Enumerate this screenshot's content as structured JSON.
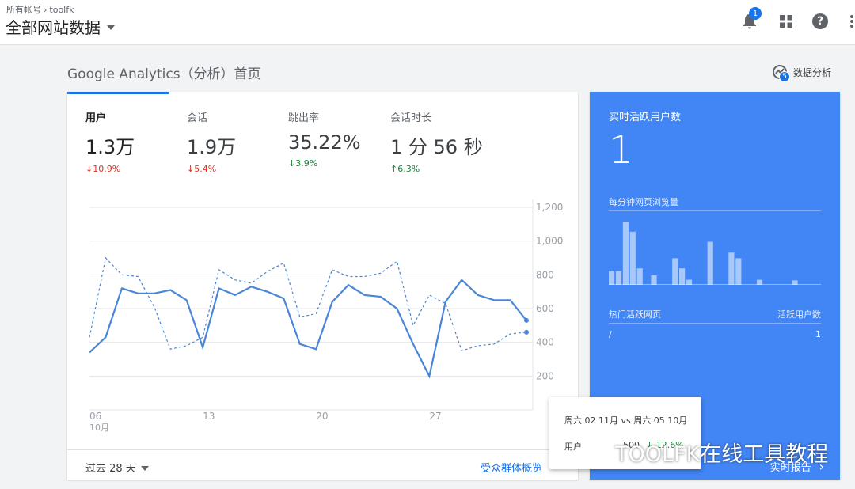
{
  "header": {
    "breadcrumb": [
      "所有帐号",
      "toolfk"
    ],
    "property_title": "全部网站数据",
    "notification_count": "1"
  },
  "page": {
    "title": "Google Analytics（分析）首页",
    "insights_label": "数据分析",
    "insights_count": "5"
  },
  "metrics": [
    {
      "label": "用户",
      "value": "1.3万",
      "change": "↓10.9%",
      "dir": "neg"
    },
    {
      "label": "会话",
      "value": "1.9万",
      "change": "↓5.4%",
      "dir": "neg"
    },
    {
      "label": "跳出率",
      "value": "35.22%",
      "change": "↓3.9%",
      "dir": "pos"
    },
    {
      "label": "会话时长",
      "value": "1 分 56 秒",
      "change": "↑6.3%",
      "dir": "pos"
    }
  ],
  "chart_data": {
    "type": "line",
    "y_tick_labels": [
      "1,200",
      "1,000",
      "800",
      "600",
      "400",
      "200"
    ],
    "ylim": [
      0,
      1200
    ],
    "x_tick_labels": [
      "06",
      "13",
      "20",
      "27"
    ],
    "x_sublabel": "10月",
    "series": [
      {
        "style": "solid",
        "color": "#4a86d8",
        "values": [
          340,
          430,
          720,
          690,
          690,
          710,
          650,
          370,
          720,
          680,
          730,
          700,
          660,
          390,
          360,
          640,
          740,
          680,
          670,
          600,
          390,
          200,
          640,
          770,
          680,
          650,
          650,
          530
        ]
      },
      {
        "style": "dashed",
        "color": "#4a86d8",
        "values": [
          430,
          900,
          800,
          790,
          610,
          360,
          380,
          430,
          830,
          770,
          750,
          820,
          870,
          550,
          570,
          830,
          790,
          790,
          810,
          880,
          500,
          680,
          630,
          350,
          380,
          390,
          450,
          460
        ]
      }
    ]
  },
  "footer": {
    "range": "过去 28 天",
    "audience_link": "受众群体概览"
  },
  "realtime": {
    "title": "实时活跃用户数",
    "count": "1",
    "pageviews_label": "每分钟网页浏览量",
    "bars": [
      0.22,
      0.22,
      1.0,
      0.84,
      0.26,
      0,
      0.15,
      0,
      0,
      0.42,
      0.26,
      0.08,
      0,
      0,
      0.68,
      0,
      0,
      0.51,
      0.42,
      0,
      0,
      0.08,
      0,
      0,
      0,
      0,
      0.07,
      0,
      0,
      0
    ],
    "table_header_page": "热门活跃网页",
    "table_header_users": "活跃用户数",
    "row_page": "/",
    "row_users": "1",
    "report_link": "实时报告"
  },
  "tooltip": {
    "title": "周六 02 11月 vs 周六 05 10月",
    "row_label": "用户",
    "row_value": "500",
    "row_change": "↓ 12.6%"
  },
  "watermark": "TOOLFK在线工具教程"
}
